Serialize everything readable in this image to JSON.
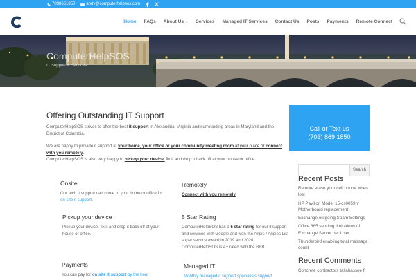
{
  "colors": {
    "accent": "#2ea3f2",
    "hero_bg": "#3c4257"
  },
  "topbar": {
    "phone": "7038651850",
    "email": "andy@computerhelpsos.com",
    "icons": [
      "phone-icon",
      "email-icon",
      "facebook-icon",
      "x-twitter-icon"
    ]
  },
  "nav": {
    "items": [
      "Home",
      "FAQs",
      "About Us",
      "Services",
      "Managed IT Services",
      "Contact Us",
      "Posts",
      "Payments",
      "Remote Connect"
    ],
    "active": "Home"
  },
  "hero": {
    "title": "ComputerHelpSOS",
    "subtitle": "IT Support & Services"
  },
  "main": {
    "heading": "Offering Outstanding IT Support",
    "intro": {
      "a": "ComputerHelpSOS strives to offer the best ",
      "b": "it support",
      "c": " in Alexandria, Virginia and surrounding areas in Maryland and the District of Columbia."
    },
    "p2": {
      "a": "We are happy to provide it support at ",
      "b": "your home, your office or your community meeting room",
      "c": " at your place or ",
      "d": "connect with you remotely",
      "e": ".",
      "f": "ComputerHelpSOS is also very happy to ",
      "g": "pickup your device,",
      "h": " fix it and drop it back off at your house or office."
    },
    "features": {
      "onsite": {
        "title": "Onsite",
        "a": "Our tech it support can come to your home or office for ",
        "b": "on-site it support",
        "c": "."
      },
      "remotely": {
        "title": "Remotely",
        "a": "Connect with you remotely"
      },
      "pickup": {
        "title": "Pickup your device",
        "a": "Pickup your device, fix it and drop it back off at your house or office."
      },
      "star": {
        "title": "5 Star Rating",
        "a": "ComputerHelpSOS has a ",
        "b": "5 star rating",
        "c": " for our it support and services with Google and won the Angis / Angies List super service award in 2019 and 2020. ComputerHelpSOS is A+ rated with the BBB."
      },
      "payments": {
        "title": "Payments",
        "a": "You can pay for ",
        "b": "on site it support",
        "c": " by the hour"
      },
      "managed": {
        "title": "Managed IT",
        "a": "Monthly managed ",
        "b": "it support specialists support"
      }
    }
  },
  "sidebar": {
    "cta_line1": "Call or Text us",
    "cta_line2": "(703) 869 1850",
    "search_placeholder": "",
    "search_button": "Search",
    "recent_posts_title": "Recent Posts",
    "recent_posts": [
      "Remote erase your cell phone when lost",
      "HP Pavilion Model 15-cs0059nr Motherboard replacement",
      "Exchange outgoing Spam Settings",
      "Office 365 sending limitations of Exchange Server per User",
      "Thunderbird enabling total message count"
    ],
    "recent_comments_title": "Recent Comments",
    "recent_comment": "Concrete contractors tallahassee fl"
  }
}
